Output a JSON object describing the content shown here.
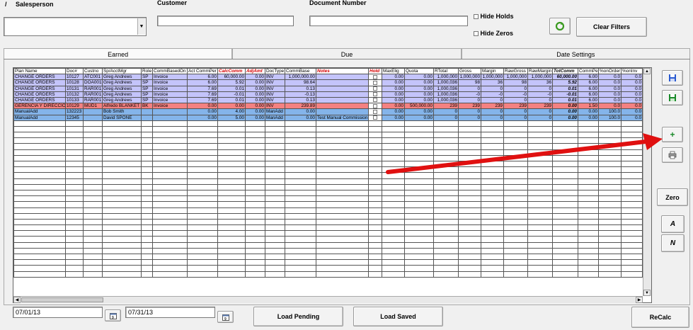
{
  "filters": {
    "salesperson_label": "Salesperson",
    "slash": "/",
    "customer_label": "Customer",
    "docnum_label": "Document Number",
    "hide_holds": "Hide Holds",
    "hide_zeros": "Hide Zeros",
    "clear_filters": "Clear Filters"
  },
  "tabs": [
    "Earned",
    "Due",
    "Date Settings"
  ],
  "columns": [
    {
      "label": "Plan Name",
      "style": ""
    },
    {
      "label": "Doc#",
      "style": ""
    },
    {
      "label": "Custno",
      "style": ""
    },
    {
      "label": "Sp/AcctMgr",
      "style": ""
    },
    {
      "label": "Role",
      "style": ""
    },
    {
      "label": "CommBasedOn",
      "style": ""
    },
    {
      "label": "Act CommPer",
      "style": ""
    },
    {
      "label": "CalcComm",
      "style": "red"
    },
    {
      "label": "AdjAmt",
      "style": "red"
    },
    {
      "label": "DocType",
      "style": ""
    },
    {
      "label": "CommBase",
      "style": ""
    },
    {
      "label": "Notes",
      "style": "red"
    },
    {
      "label": "Hold",
      "style": "red"
    },
    {
      "label": "MaxElig",
      "style": ""
    },
    {
      "label": "Quota",
      "style": ""
    },
    {
      "label": "RTotal",
      "style": ""
    },
    {
      "label": "Gross",
      "style": ""
    },
    {
      "label": "Margin",
      "style": ""
    },
    {
      "label": "RawGross",
      "style": ""
    },
    {
      "label": "RawMargin",
      "style": ""
    },
    {
      "label": "TotComm",
      "style": "blk"
    },
    {
      "label": "CommPer",
      "style": ""
    },
    {
      "label": "%onOrder",
      "style": ""
    },
    {
      "label": "%onInv",
      "style": ""
    }
  ],
  "rows": [
    {
      "color": "lav",
      "cells": [
        "CHANGE ORDERS",
        "10127",
        "ATC001",
        "Greg Andrews",
        "SP",
        "Invoice",
        "6.00",
        "60,000.00",
        "0.00",
        "INV",
        "1,000,000.00",
        "",
        "",
        "0.00",
        "0.00",
        "1,000,000",
        "1,000,000",
        "1,000,000",
        "1,000,000",
        "1,000,000",
        "60,000.00",
        "6.00",
        "0.0",
        "0.0"
      ]
    },
    {
      "color": "lav",
      "cells": [
        "CHANGE ORDERS",
        "10128",
        "DOA001",
        "Greg Andrews",
        "SP",
        "Invoice",
        "6.00",
        "5.92",
        "0.00",
        "INV",
        "98.64",
        "",
        "",
        "0.00",
        "0.00",
        "1,000,036",
        "98",
        "36",
        "98",
        "36",
        "5.92",
        "6.00",
        "0.0",
        "0.0"
      ]
    },
    {
      "color": "lav",
      "cells": [
        "CHANGE ORDERS",
        "10131",
        "RAR001",
        "Greg Andrews",
        "SP",
        "Invoice",
        "7.69",
        "0.01",
        "0.00",
        "INV",
        "0.13",
        "",
        "",
        "0.00",
        "0.00",
        "1,000,036",
        "0",
        "0",
        "0",
        "0",
        "0.01",
        "6.00",
        "0.0",
        "0.0"
      ]
    },
    {
      "color": "lav",
      "cells": [
        "CHANGE ORDERS",
        "10132",
        "RAR001",
        "Greg Andrews",
        "SP",
        "Invoice",
        "7.69",
        "-0.01",
        "0.00",
        "INV",
        "-0.13",
        "",
        "",
        "0.00",
        "0.00",
        "1,000,036",
        "-0",
        "-0",
        "-0",
        "-0",
        "-0.01",
        "6.00",
        "0.0",
        "0.0"
      ]
    },
    {
      "color": "lav",
      "cells": [
        "CHANGE ORDERS",
        "10133",
        "RAR001",
        "Greg Andrews",
        "SP",
        "Invoice",
        "7.69",
        "0.01",
        "0.00",
        "INV",
        "0.13",
        "",
        "",
        "0.00",
        "0.00",
        "1,000,036",
        "0",
        "0",
        "0",
        "0",
        "0.01",
        "6.00",
        "0.0",
        "0.0"
      ]
    },
    {
      "color": "sal",
      "cells": [
        "GERENCIA Y DIRECCION",
        "10129",
        "MUD1",
        "Alfredo BLANKET",
        "BK",
        "Invoice",
        "0.00",
        "0.00",
        "0.00",
        "INV",
        "239.89",
        "",
        "",
        "0.00",
        "500,000.00",
        "239",
        "239",
        "239",
        "239",
        "239",
        "0.00",
        "1.50",
        "0.0",
        "0.0"
      ]
    },
    {
      "color": "blu",
      "cells": [
        "ManualAdd",
        "132223",
        "",
        "Bob Smith",
        "",
        "",
        "0.00",
        "4.00",
        "0.00",
        "ManAdd",
        "0.00",
        "",
        "",
        "0.00",
        "0.00",
        "0",
        "0",
        "0",
        "0",
        "0",
        "0.00",
        "0.00",
        "100.0",
        "0.0"
      ]
    },
    {
      "color": "blu",
      "cells": [
        "ManualAdd",
        "12345",
        "",
        "David SPONE",
        "",
        "",
        "0.00",
        "5.00",
        "0.00",
        "ManAdd",
        "0.00",
        "Test Manual Commission",
        "",
        "0.00",
        "0.00",
        "0",
        "0",
        "0",
        "0",
        "0",
        "0.00",
        "0.00",
        "100.0",
        "0.0"
      ]
    }
  ],
  "bottom": {
    "date_from": "07/01/13",
    "date_to": "07/31/13",
    "load_pending": "Load Pending",
    "load_saved": "Load Saved",
    "recalc": "ReCalc"
  },
  "side": {
    "zero": "Zero",
    "a": "A",
    "n": "N"
  },
  "colors": {
    "lavender_row": "#c4c4fb",
    "salmon_row": "#f48181",
    "blue_row": "#84b4ea",
    "arrow": "#e01010"
  }
}
